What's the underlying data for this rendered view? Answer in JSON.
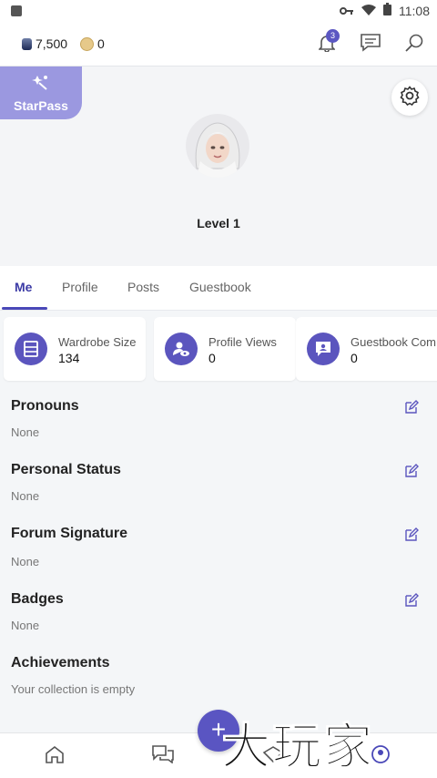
{
  "status_bar": {
    "time": "11:08"
  },
  "top_bar": {
    "gems": "7,500",
    "coins": "0",
    "notification_count": "3",
    "icons": [
      "bell-icon",
      "message-icon",
      "search-icon"
    ]
  },
  "header": {
    "starpass_label": "StarPass",
    "level": "Level 1"
  },
  "tabs": [
    {
      "label": "Me"
    },
    {
      "label": "Profile"
    },
    {
      "label": "Posts"
    },
    {
      "label": "Guestbook"
    }
  ],
  "stats": [
    {
      "label": "Wardrobe Size",
      "value": "134",
      "icon": "wardrobe-icon"
    },
    {
      "label": "Profile Views",
      "value": "0",
      "icon": "profile-views-icon"
    },
    {
      "label": "Guestbook Com",
      "value": "0",
      "icon": "guestbook-icon"
    }
  ],
  "sections": [
    {
      "title": "Pronouns",
      "value": "None",
      "editable": true
    },
    {
      "title": "Personal Status",
      "value": "None",
      "editable": true
    },
    {
      "title": "Forum Signature",
      "value": "None",
      "editable": true
    },
    {
      "title": "Badges",
      "value": "None",
      "editable": true
    },
    {
      "title": "Achievements",
      "value": "Your collection is empty",
      "editable": false
    }
  ],
  "bottom_nav": [
    "home-icon",
    "chat-icon",
    "catalog-icon",
    "profile-icon"
  ],
  "fab_label": "+",
  "watermark": "大玩家",
  "colors": {
    "accent": "#5b55be",
    "starpass": "#9b98e0"
  }
}
